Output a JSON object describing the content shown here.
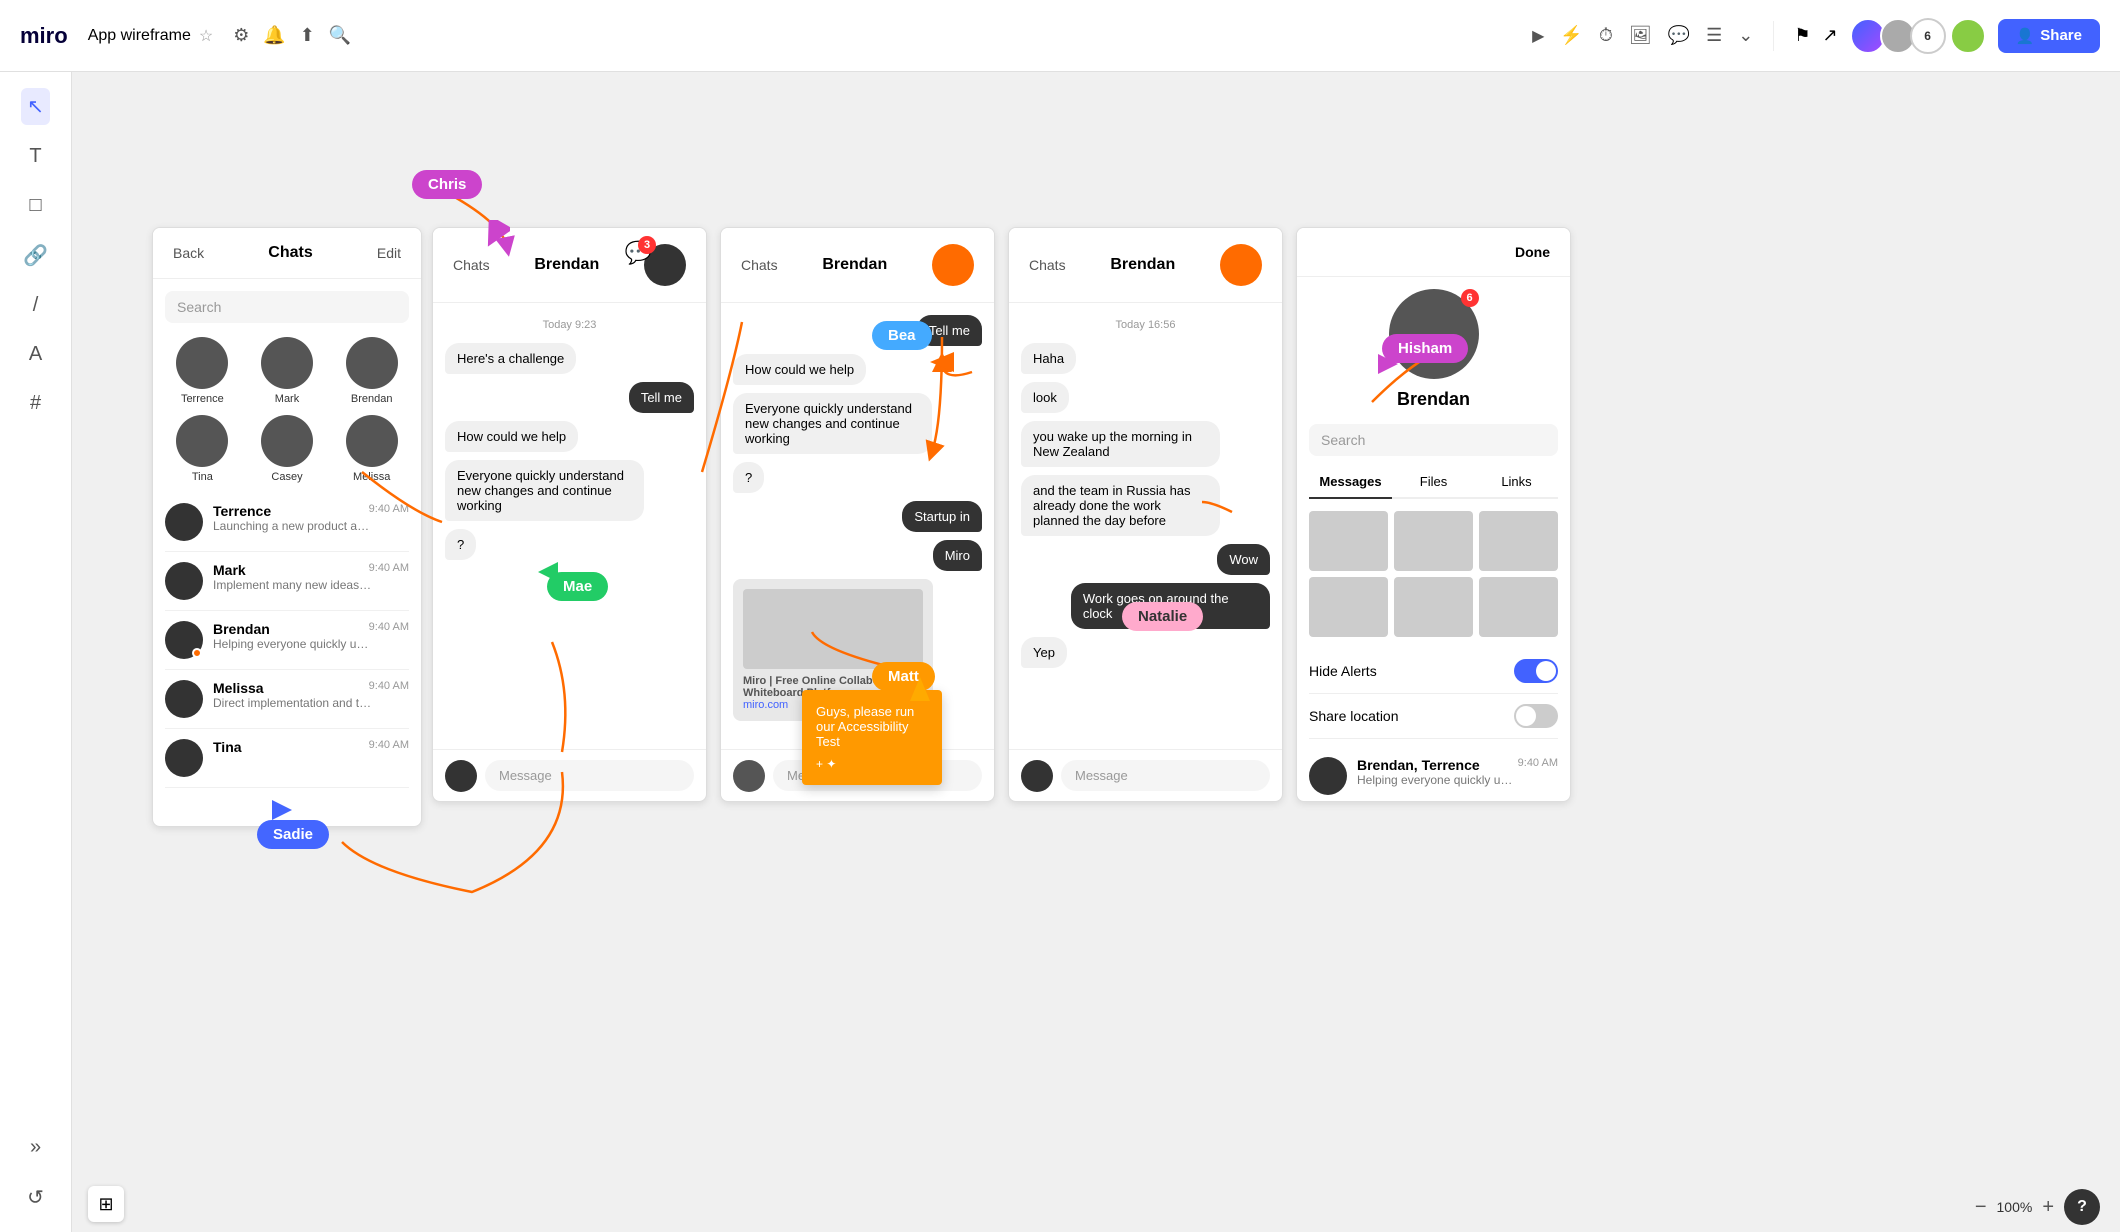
{
  "topnav": {
    "logo": "miro",
    "title": "App wireframe",
    "share_label": "Share"
  },
  "panels": {
    "p1": {
      "back": "Back",
      "title": "Chats",
      "edit": "Edit",
      "search_placeholder": "Search",
      "contacts": [
        {
          "name": "Terrence"
        },
        {
          "name": "Mark"
        },
        {
          "name": "Brendan"
        },
        {
          "name": "Tina"
        },
        {
          "name": "Casey"
        },
        {
          "name": "Melissa"
        }
      ],
      "chat_items": [
        {
          "name": "Terrence",
          "time": "9:40 AM",
          "msg": "Launching a new product as a fully remote team required an easy way..."
        },
        {
          "name": "Mark",
          "time": "9:40 AM",
          "msg": "Implement many new ideas and suggestions from the team"
        },
        {
          "name": "Brendan",
          "time": "9:40 AM",
          "msg": "Helping everyone quickly understand new changes and continue working"
        },
        {
          "name": "Melissa",
          "time": "9:40 AM",
          "msg": "Direct implementation and the development of a minimum viable prod..."
        },
        {
          "name": "Tina",
          "time": "9:40 AM",
          "msg": ""
        }
      ]
    },
    "p2": {
      "back": "Chats",
      "title": "Brendan",
      "timestamp": "Today 9:23",
      "messages": [
        {
          "text": "Here's a challenge",
          "type": "left"
        },
        {
          "text": "Tell me",
          "type": "right"
        },
        {
          "text": "How could we help",
          "type": "left"
        },
        {
          "text": "Everyone quickly understand new changes and continue working",
          "type": "left"
        },
        {
          "text": "?",
          "type": "left"
        }
      ],
      "input_placeholder": "Message"
    },
    "p3": {
      "back": "Chats",
      "title": "Brendan",
      "messages": [
        {
          "text": "Tell me",
          "type": "right"
        },
        {
          "text": "How could we help",
          "type": "left"
        },
        {
          "text": "Everyone quickly understand new changes and continue working",
          "type": "left"
        },
        {
          "text": "?",
          "type": "left"
        },
        {
          "text": "Startup in",
          "type": "right"
        },
        {
          "text": "Miro",
          "type": "right"
        }
      ],
      "link": {
        "title": "Miro | Free Online Collaborative Whiteboard Platform",
        "url": "miro.com"
      },
      "input_placeholder": "Message"
    },
    "p4": {
      "back": "Chats",
      "title": "Brendan",
      "timestamp": "Today 16:56",
      "messages": [
        {
          "text": "Haha",
          "type": "left"
        },
        {
          "text": "look",
          "type": "left"
        },
        {
          "text": "you wake up the morning in New Zealand",
          "type": "left"
        },
        {
          "text": "and the team in Russia has already done the work planned the day before",
          "type": "left"
        },
        {
          "text": "Wow",
          "type": "right"
        },
        {
          "text": "Work goes on around the clock",
          "type": "right"
        },
        {
          "text": "Yep",
          "type": "left"
        }
      ],
      "input_placeholder": "Message"
    },
    "p5": {
      "done": "Done",
      "name": "Brendan",
      "tabs": [
        "Messages",
        "Files",
        "Links"
      ],
      "active_tab": "Messages",
      "search_placeholder": "Search",
      "hide_alerts": "Hide Alerts",
      "share_location": "Share location",
      "last_chat_name": "Brendan, Terrence",
      "last_chat_time": "9:40 AM",
      "last_chat_msg": "Helping everyone quickly understand new changes and continue working",
      "notif_count": "6"
    }
  },
  "annotations": {
    "chris": "Chris",
    "mae": "Mae",
    "bea": "Bea",
    "matt": "Matt",
    "sadie": "Sadie",
    "hisham": "Hisham",
    "natalie": "Natalie"
  },
  "sticky": {
    "text": "Guys, please run our Accessibility Test",
    "icon": "+ ✦"
  },
  "bottombar": {
    "zoom": "100%",
    "zoom_minus": "−",
    "zoom_plus": "+",
    "help": "?"
  }
}
